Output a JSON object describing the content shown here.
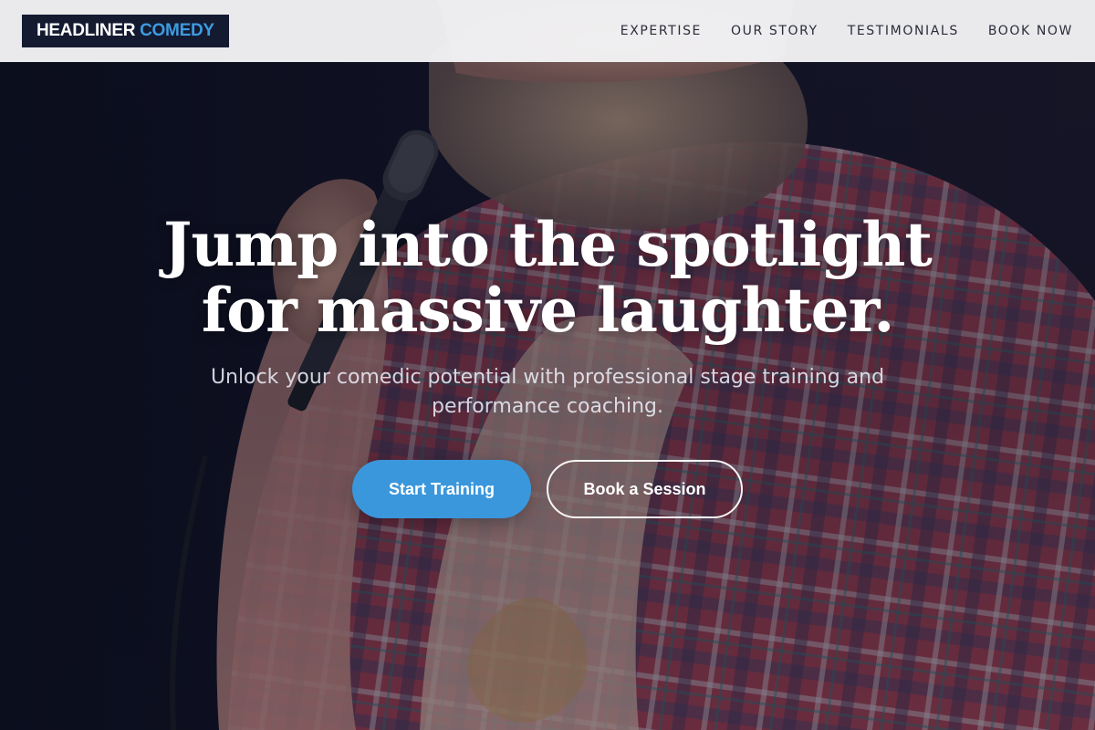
{
  "brand": {
    "name_part1": "HEADLINER",
    "name_part2": "COMEDY"
  },
  "nav": {
    "items": [
      {
        "label": "EXPERTISE"
      },
      {
        "label": "OUR STORY"
      },
      {
        "label": "TESTIMONIALS"
      },
      {
        "label": "BOOK NOW"
      }
    ]
  },
  "hero": {
    "headline_line1": "Jump into the spotlight",
    "headline_line2": "for massive laughter.",
    "subtitle": "Unlock your comedic potential with professional stage training and performance coaching.",
    "primary_cta": "Start Training",
    "secondary_cta": "Book a Session",
    "background_image": "comedian-with-microphone-photo"
  },
  "colors": {
    "accent": "#3a97dc",
    "header_bg": "#f4f4f6",
    "logo_bg": "#141a30",
    "nav_text": "#2a2d3a"
  }
}
